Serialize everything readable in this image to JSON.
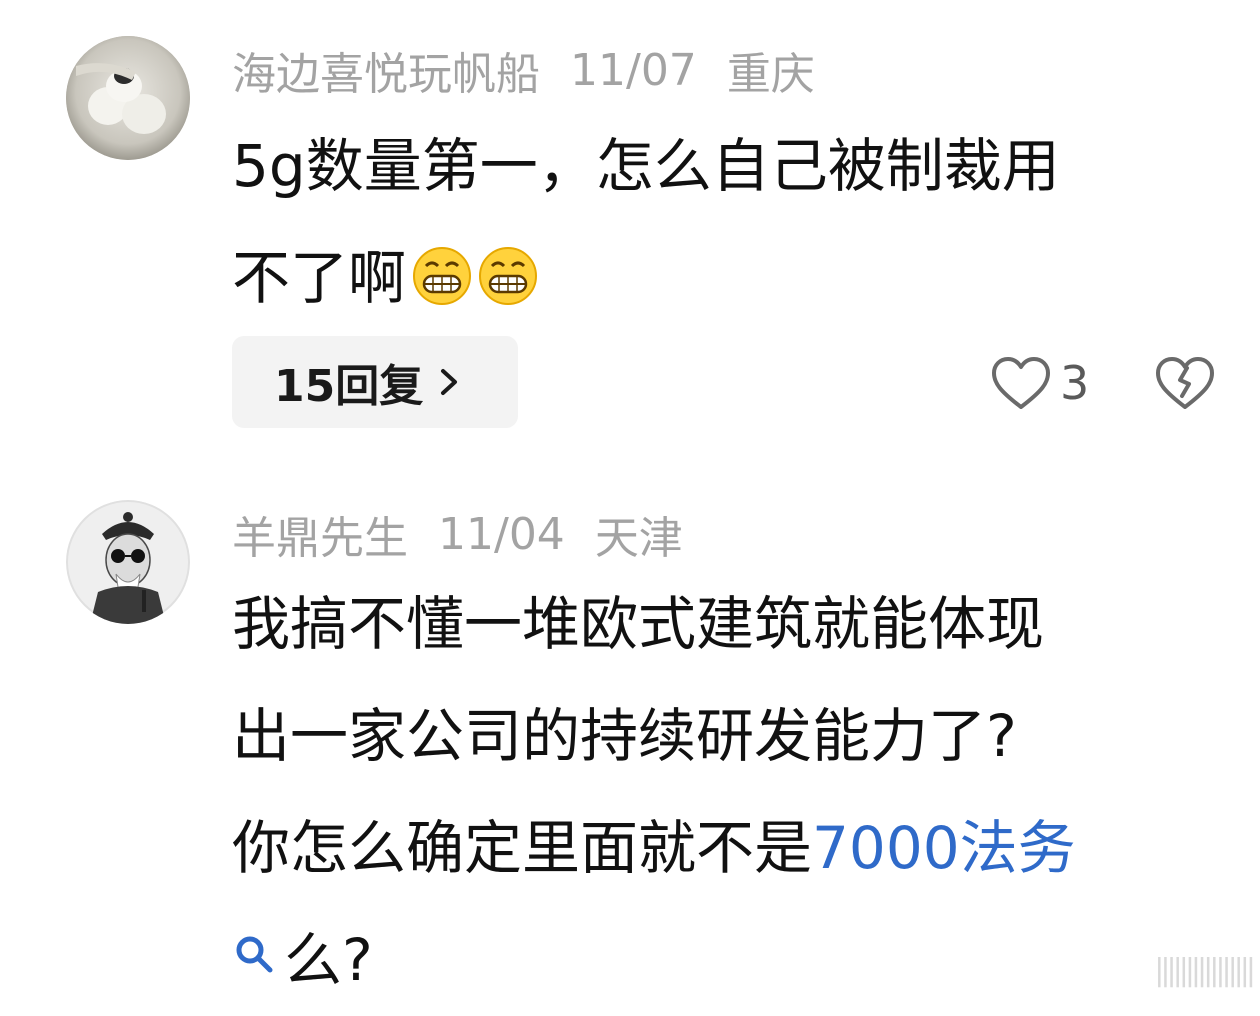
{
  "comments": [
    {
      "username": "海边喜悦玩帆船",
      "date": "11/07",
      "location": "重庆",
      "text_line1": "5g数量第一，怎么自己被制裁用",
      "text_line2": "不了啊",
      "emoji": [
        "grinning-face-emoji",
        "grinning-face-emoji"
      ],
      "reply_label": "15回复",
      "likes": "3"
    },
    {
      "username": "羊鼎先生",
      "date": "11/04",
      "location": "天津",
      "text_line1": "我搞不懂一堆欧式建筑就能体现",
      "text_line2": "出一家公司的持续研发能力了?",
      "text_line3_prefix": "你怎么确定里面就不是",
      "text_line3_link": "7000法务",
      "text_line4": "么?"
    }
  ],
  "colors": {
    "meta_gray": "#a3a3a3",
    "link_blue": "#2f6ac9",
    "pill_bg": "#f3f3f3"
  }
}
